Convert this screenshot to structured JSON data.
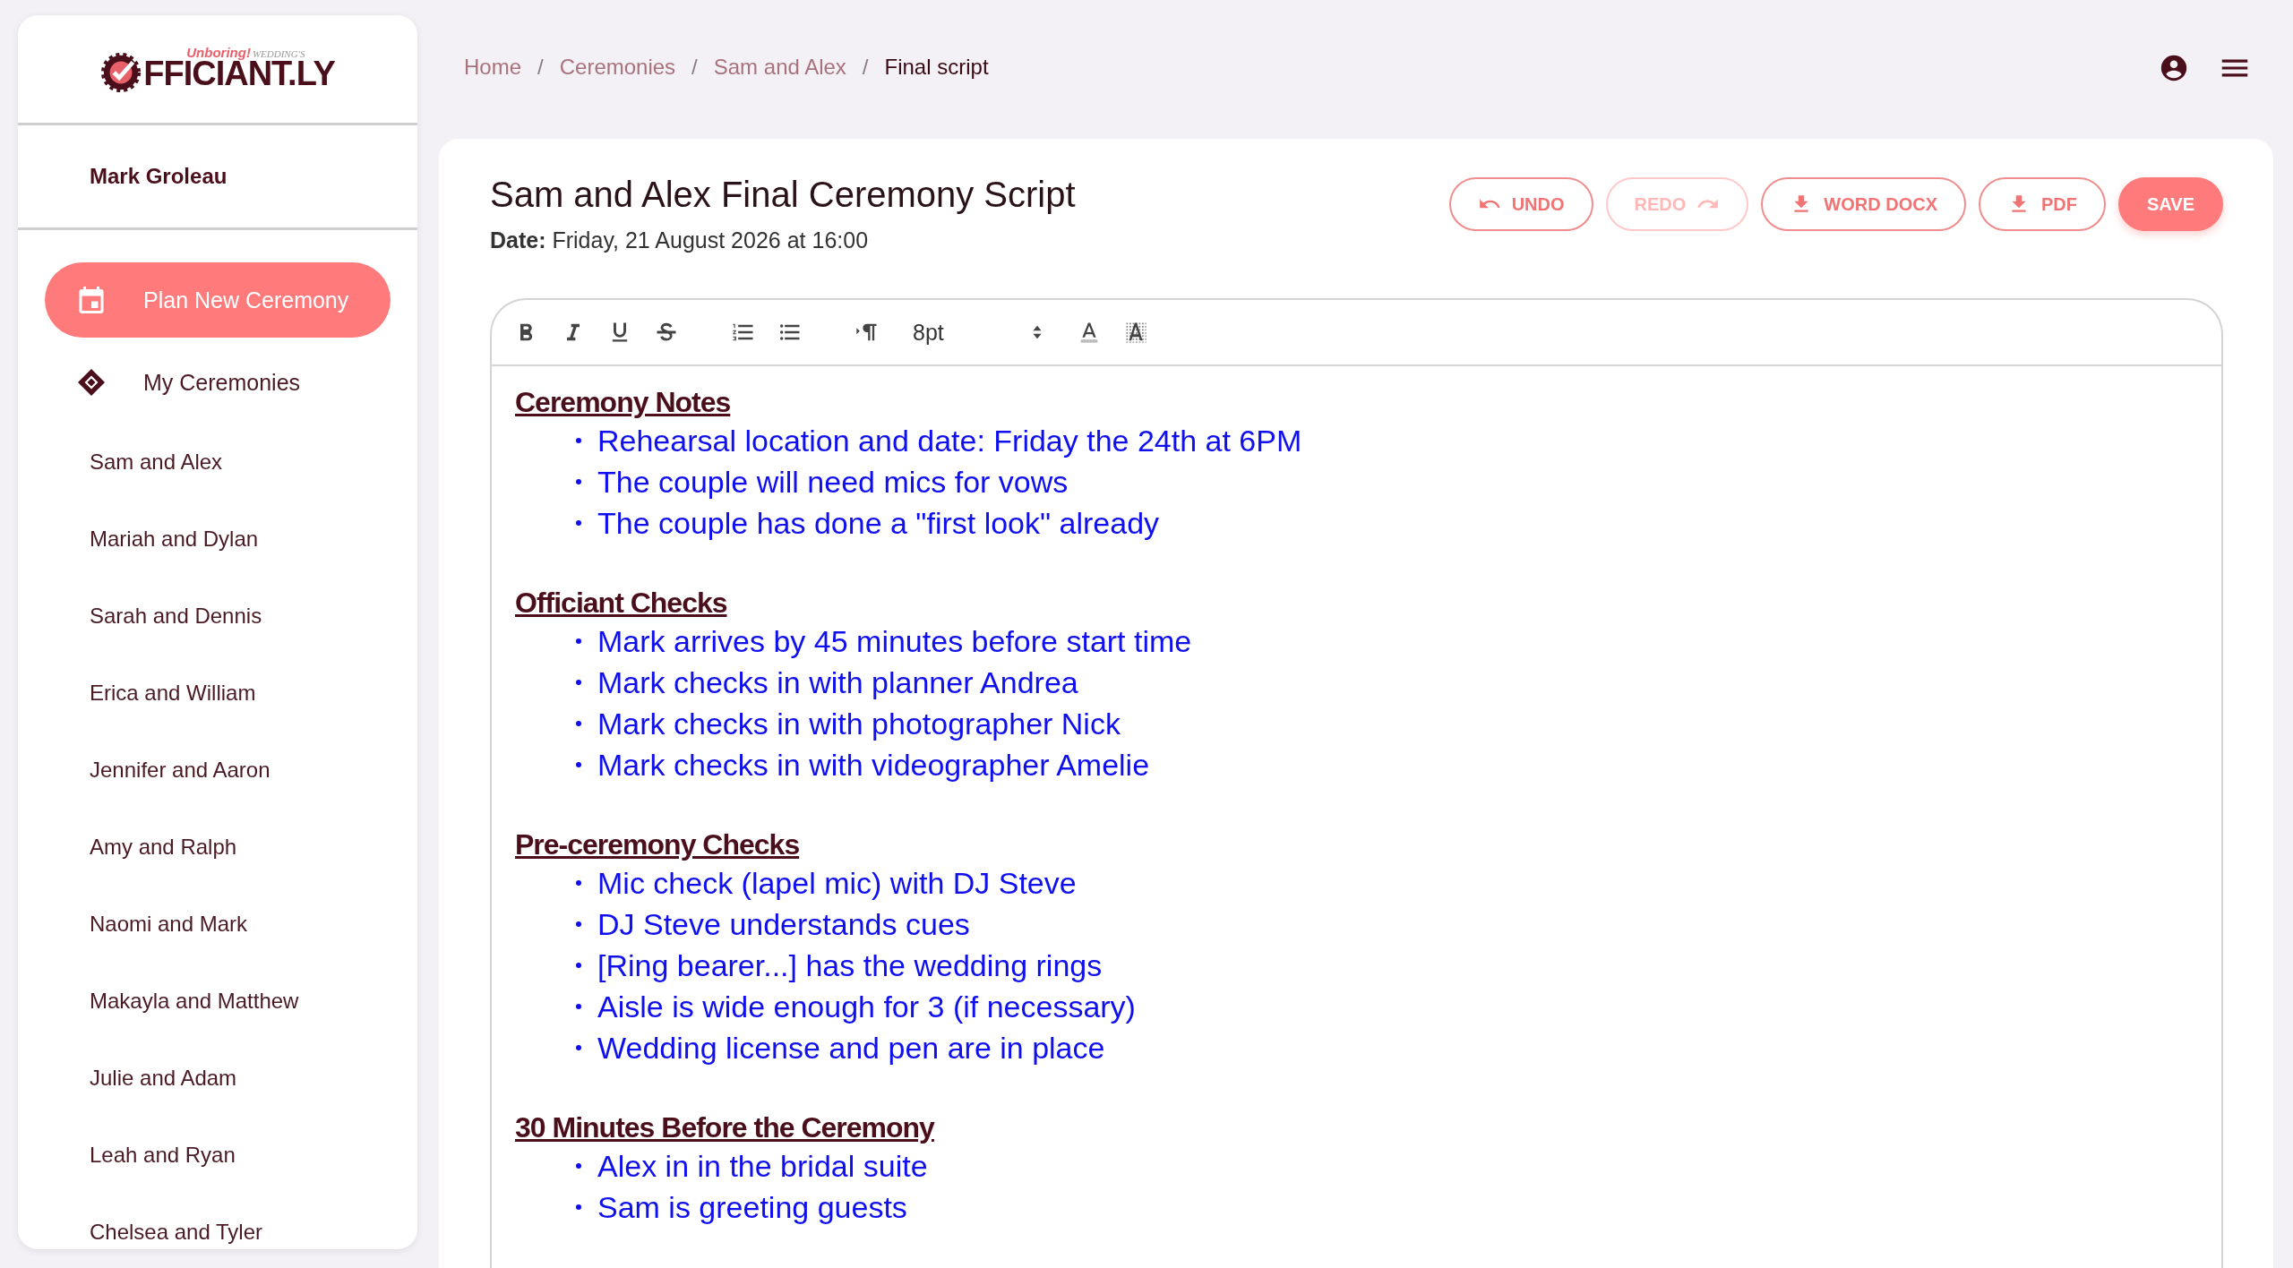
{
  "logo": {
    "tagline": "Unboring!",
    "tagline_suffix": "WEDDING'S",
    "wordmark": "FFICIANT.LY"
  },
  "user": {
    "name": "Mark Groleau"
  },
  "nav": [
    {
      "label": "Plan New Ceremony",
      "kind": "calendar",
      "selected": true
    },
    {
      "label": "My Ceremonies",
      "kind": "rings",
      "selected": false
    }
  ],
  "ceremonies": [
    "Sam and Alex",
    "Mariah and Dylan",
    "Sarah and Dennis",
    "Erica and William",
    "Jennifer and Aaron",
    "Amy and Ralph",
    "Naomi and Mark",
    "Makayla and Matthew",
    "Julie and Adam",
    "Leah and Ryan",
    "Chelsea and Tyler"
  ],
  "breadcrumbs": [
    {
      "label": "Home",
      "current": false
    },
    {
      "separator": "/",
      "label": "Ceremonies",
      "current": false
    },
    {
      "separator": "/",
      "label": "Sam and Alex",
      "current": false
    },
    {
      "separator": "/",
      "label": "Final script",
      "current": true
    }
  ],
  "document": {
    "title": "Sam and Alex Final Ceremony Script",
    "date_label": "Date:",
    "date": "Friday, 21 August 2026 at 16:00"
  },
  "actions": [
    {
      "label": "UNDO",
      "kind": "undo",
      "disabled": false
    },
    {
      "label": "REDO",
      "kind": "redo",
      "disabled": true
    },
    {
      "label": "WORD DOCX",
      "kind": "download",
      "disabled": false
    },
    {
      "label": "PDF",
      "kind": "download",
      "disabled": false
    },
    {
      "label": "SAVE",
      "kind": "primary",
      "disabled": false
    }
  ],
  "toolbar": [
    {
      "kind": "bold"
    },
    {
      "kind": "italic"
    },
    {
      "kind": "underline"
    },
    {
      "kind": "strike"
    },
    {
      "kind": "sep"
    },
    {
      "kind": "ordered"
    },
    {
      "kind": "bullets"
    },
    {
      "kind": "sep"
    },
    {
      "kind": "direction"
    },
    {
      "kind": "size",
      "value": "8pt"
    },
    {
      "kind": "color"
    },
    {
      "kind": "highlight"
    }
  ],
  "sections": [
    {
      "heading": "Ceremony Notes",
      "items": [
        "Rehearsal location and date: Friday the 24th at 6PM",
        "The couple will need mics for vows",
        "The couple has done a \"first look\" already"
      ]
    },
    {
      "heading": "Officiant Checks",
      "items": [
        "Mark arrives by 45 minutes before start time",
        "Mark checks in with planner Andrea",
        "Mark checks in with photographer Nick",
        "Mark checks in with videographer Amelie"
      ]
    },
    {
      "heading": "Pre-ceremony Checks",
      "items": [
        "Mic check (lapel mic) with DJ Steve",
        "DJ Steve understands cues",
        "[Ring bearer...] has the wedding rings",
        "Aisle is wide enough for 3 (if necessary)",
        "Wedding license and pen are in place"
      ]
    },
    {
      "heading": "30 Minutes Before the Ceremony",
      "items": [
        "Alex in in the bridal suite",
        "Sam is greeting guests"
      ]
    }
  ]
}
